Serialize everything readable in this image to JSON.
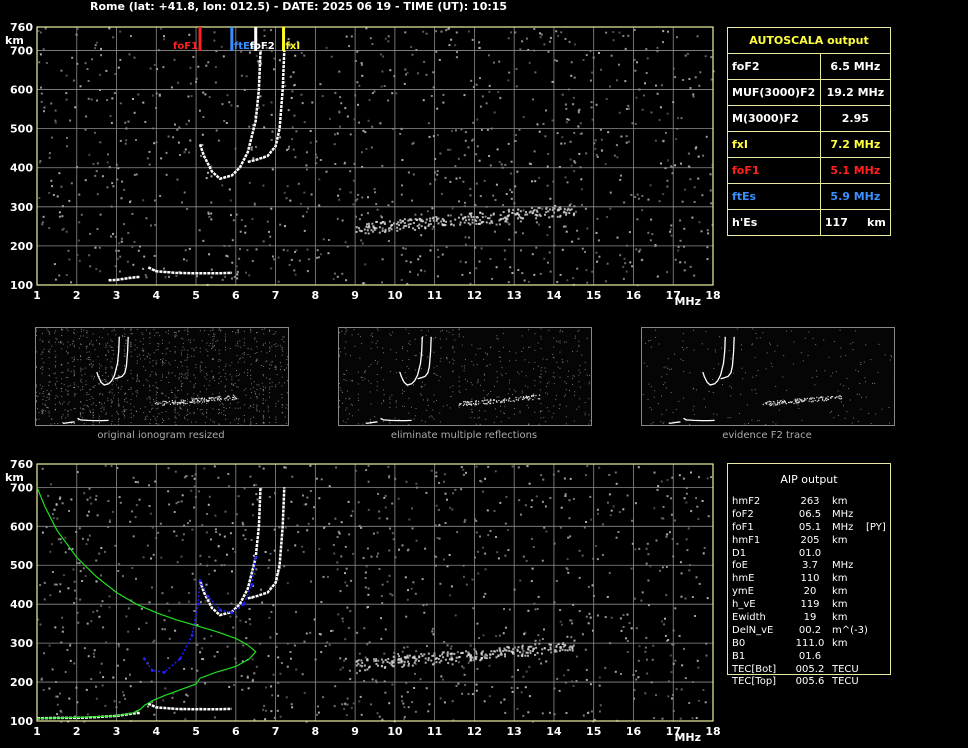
{
  "header": {
    "title": "Rome (lat: +41.8, lon: 012.5) - DATE: 2025 06 19 - TIME (UT): 10:15"
  },
  "colors": {
    "frame": "#f0f0a0",
    "grid": "#8c8c8c",
    "trace": "#ffffff",
    "foF1": "#ff2020",
    "ftEs": "#3a8fff",
    "foF2": "#ffffff",
    "fxI": "#ffff20",
    "profile": "#20e020",
    "model": "#2020ff",
    "noise": "#b4b4b4"
  },
  "autoscala": {
    "title": "AUTOSCALA output",
    "rows": [
      {
        "label": "foF2",
        "value": "6.5 MHz",
        "color": "#ffffff"
      },
      {
        "label": "MUF(3000)F2",
        "value": "19.2 MHz",
        "color": "#ffffff"
      },
      {
        "label": "M(3000)F2",
        "value": "2.95",
        "color": "#ffffff"
      },
      {
        "label": "fxI",
        "value": "7.2 MHz",
        "color": "#ffff40"
      },
      {
        "label": "foF1",
        "value": "5.1 MHz",
        "color": "#ff2020"
      },
      {
        "label": "ftEs",
        "value": "5.9 MHz",
        "color": "#3a8fff"
      },
      {
        "label": "h'Es",
        "value": "117     km",
        "color": "#ffffff"
      }
    ]
  },
  "aip": {
    "title": "AIP output",
    "rows": [
      {
        "k": "hmF2",
        "v": "263",
        "u": "km",
        "x": ""
      },
      {
        "k": "foF2",
        "v": "06.5",
        "u": "MHz",
        "x": ""
      },
      {
        "k": "foF1",
        "v": "05.1",
        "u": "MHz",
        "x": "[PY]"
      },
      {
        "k": "hmF1",
        "v": "205",
        "u": "km",
        "x": ""
      },
      {
        "k": "D1",
        "v": "01.0",
        "u": "",
        "x": ""
      },
      {
        "k": "foE",
        "v": "3.7",
        "u": "MHz",
        "x": ""
      },
      {
        "k": "hmE",
        "v": "110",
        "u": "km",
        "x": ""
      },
      {
        "k": "ymE",
        "v": "20",
        "u": "km",
        "x": ""
      },
      {
        "k": "h_vE",
        "v": "119",
        "u": "km",
        "x": ""
      },
      {
        "k": "Ewidth",
        "v": "19",
        "u": "km",
        "x": ""
      },
      {
        "k": "DelN_vE",
        "v": "00.2",
        "u": "m^(-3)",
        "x": ""
      },
      {
        "k": "B0",
        "v": "111.0",
        "u": "km",
        "x": ""
      },
      {
        "k": "B1",
        "v": "01.6",
        "u": "",
        "x": ""
      },
      {
        "k": "TEC[Bot]",
        "v": "005.2",
        "u": "TECU",
        "x": ""
      },
      {
        "k": "TEC[Top]",
        "v": "005.6",
        "u": "TECU",
        "x": ""
      }
    ]
  },
  "thumbnails": [
    {
      "caption": "original ionogram resized"
    },
    {
      "caption": "eliminate multiple reflections"
    },
    {
      "caption": "evidence F2 trace"
    }
  ],
  "chart_data": [
    {
      "type": "scatter",
      "x_unit": "MHz",
      "y_unit": "km",
      "xlim": [
        1,
        18
      ],
      "ylim": [
        100,
        760
      ],
      "xticks": [
        "1",
        "2",
        "3",
        "4",
        "5",
        "6",
        "7",
        "8",
        "9",
        "10",
        "11",
        "12",
        "13",
        "14",
        "15",
        "16",
        "17",
        "18"
      ],
      "yticks": [
        "100",
        "200",
        "300",
        "400",
        "500",
        "600",
        "700",
        "760"
      ],
      "markers": [
        {
          "name": "foF1",
          "f": 5.1,
          "color": "#ff2020"
        },
        {
          "name": "ftEs",
          "f": 5.9,
          "color": "#3a8fff"
        },
        {
          "name": "foF2",
          "f": 6.5,
          "color": "#ffffff"
        },
        {
          "name": "fxI",
          "f": 7.2,
          "color": "#ffff20"
        }
      ],
      "traces": [
        {
          "name": "Es",
          "points": [
            [
              2.8,
              112
            ],
            [
              3.0,
              113
            ],
            [
              3.2,
              116
            ],
            [
              3.4,
              119
            ],
            [
              3.6,
              121
            ]
          ]
        },
        {
          "name": "E",
          "points": [
            [
              3.8,
              145
            ],
            [
              3.9,
              140
            ],
            [
              4.0,
              135
            ],
            [
              4.5,
              131
            ],
            [
              5.0,
              130
            ],
            [
              5.5,
              130
            ],
            [
              5.9,
              131
            ]
          ]
        },
        {
          "name": "F-o",
          "points": [
            [
              5.1,
              460
            ],
            [
              5.2,
              430
            ],
            [
              5.4,
              390
            ],
            [
              5.6,
              372
            ],
            [
              5.9,
              380
            ],
            [
              6.1,
              400
            ],
            [
              6.3,
              440
            ],
            [
              6.5,
              520
            ],
            [
              6.58,
              600
            ],
            [
              6.62,
              700
            ]
          ]
        },
        {
          "name": "F-x",
          "points": [
            [
              6.3,
              415
            ],
            [
              6.5,
              420
            ],
            [
              6.8,
              430
            ],
            [
              7.0,
              455
            ],
            [
              7.1,
              500
            ],
            [
              7.18,
              600
            ],
            [
              7.22,
              700
            ]
          ]
        }
      ]
    },
    {
      "type": "scatter",
      "x_unit": "MHz",
      "y_unit": "km",
      "xlim": [
        1,
        18
      ],
      "ylim": [
        100,
        760
      ],
      "xticks": [
        "1",
        "2",
        "3",
        "4",
        "5",
        "6",
        "7",
        "8",
        "9",
        "10",
        "11",
        "12",
        "13",
        "14",
        "15",
        "16",
        "17",
        "18"
      ],
      "yticks": [
        "100",
        "200",
        "300",
        "400",
        "500",
        "600",
        "700",
        "760"
      ],
      "profile": [
        [
          1.0,
          700
        ],
        [
          1.2,
          650
        ],
        [
          1.5,
          590
        ],
        [
          2.0,
          520
        ],
        [
          2.5,
          470
        ],
        [
          3.0,
          430
        ],
        [
          3.5,
          400
        ],
        [
          4.0,
          378
        ],
        [
          4.5,
          360
        ],
        [
          5.0,
          345
        ],
        [
          5.5,
          330
        ],
        [
          6.0,
          312
        ],
        [
          6.3,
          295
        ],
        [
          6.5,
          278
        ],
        [
          6.35,
          260
        ],
        [
          6.0,
          240
        ],
        [
          5.5,
          225
        ],
        [
          5.1,
          210
        ],
        [
          5.0,
          195
        ],
        [
          4.6,
          180
        ],
        [
          4.2,
          165
        ],
        [
          3.9,
          152
        ],
        [
          3.7,
          140
        ],
        [
          3.6,
          130
        ],
        [
          3.4,
          120
        ],
        [
          3.0,
          113
        ],
        [
          2.0,
          109
        ],
        [
          1.0,
          107
        ]
      ],
      "model": [
        [
          3.7,
          260
        ],
        [
          3.9,
          230
        ],
        [
          4.2,
          225
        ],
        [
          4.6,
          260
        ],
        [
          4.9,
          320
        ],
        [
          5.05,
          400
        ],
        [
          5.1,
          460
        ],
        [
          5.3,
          420
        ],
        [
          5.6,
          385
        ],
        [
          5.9,
          378
        ],
        [
          6.2,
          400
        ],
        [
          6.4,
          450
        ],
        [
          6.5,
          520
        ]
      ],
      "traces": [
        {
          "name": "Es",
          "points": [
            [
              1.0,
              107
            ],
            [
              1.5,
              108
            ],
            [
              2.0,
              108
            ],
            [
              2.5,
              110
            ],
            [
              2.8,
              112
            ],
            [
              3.0,
              113
            ],
            [
              3.2,
              116
            ],
            [
              3.4,
              119
            ],
            [
              3.6,
              121
            ]
          ]
        },
        {
          "name": "E",
          "points": [
            [
              3.8,
              145
            ],
            [
              4.0,
              135
            ],
            [
              4.5,
              131
            ],
            [
              5.0,
              130
            ],
            [
              5.5,
              130
            ],
            [
              5.9,
              131
            ]
          ]
        },
        {
          "name": "F-o",
          "points": [
            [
              5.1,
              460
            ],
            [
              5.2,
              430
            ],
            [
              5.4,
              390
            ],
            [
              5.6,
              372
            ],
            [
              5.9,
              380
            ],
            [
              6.1,
              400
            ],
            [
              6.3,
              440
            ],
            [
              6.5,
              520
            ],
            [
              6.58,
              600
            ],
            [
              6.62,
              700
            ]
          ]
        },
        {
          "name": "F-x",
          "points": [
            [
              6.3,
              415
            ],
            [
              6.5,
              420
            ],
            [
              6.8,
              430
            ],
            [
              7.0,
              455
            ],
            [
              7.1,
              500
            ],
            [
              7.18,
              600
            ],
            [
              7.22,
              700
            ]
          ]
        }
      ]
    }
  ]
}
